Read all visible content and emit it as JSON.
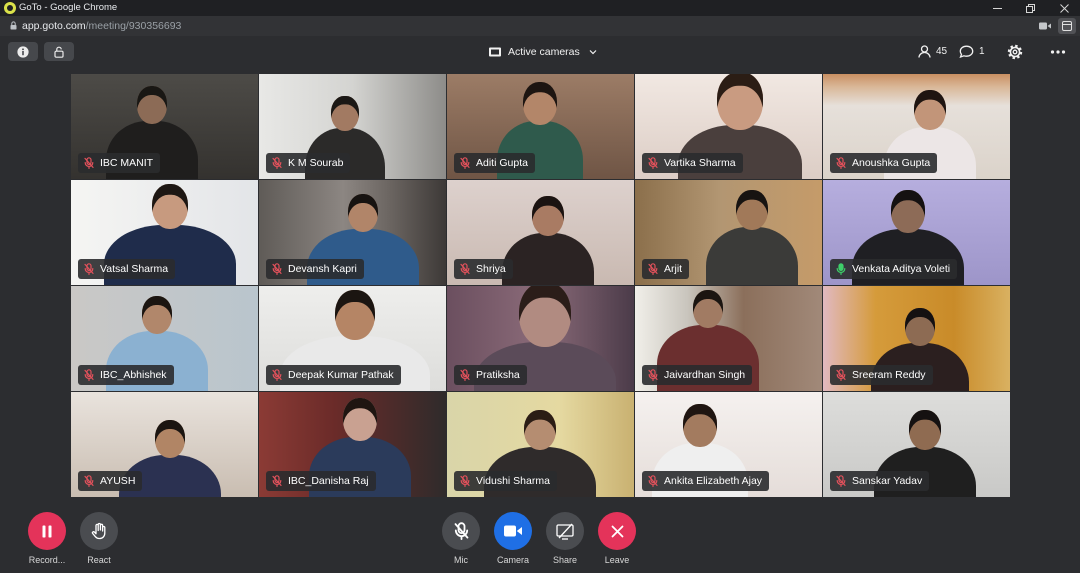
{
  "browser": {
    "window_title": "GoTo - Google Chrome",
    "url_host": "app.goto.com",
    "url_path": "/meeting/930356693"
  },
  "meeting_toolbar": {
    "view_mode": "Active cameras",
    "participant_count": "45",
    "chat_unread_count": "1"
  },
  "participants": [
    {
      "name": "IBC MANIT",
      "muted": true
    },
    {
      "name": "K M Sourab",
      "muted": true
    },
    {
      "name": "Aditi Gupta",
      "muted": true
    },
    {
      "name": "Vartika Sharma",
      "muted": true
    },
    {
      "name": "Anoushka Gupta",
      "muted": true
    },
    {
      "name": "Vatsal Sharma",
      "muted": true
    },
    {
      "name": "Devansh Kapri",
      "muted": true
    },
    {
      "name": "Shriya",
      "muted": true
    },
    {
      "name": "Arjit",
      "muted": true
    },
    {
      "name": "Venkata Aditya Voleti",
      "muted": false
    },
    {
      "name": "IBC_Abhishek",
      "muted": true
    },
    {
      "name": "Deepak Kumar Pathak",
      "muted": true
    },
    {
      "name": "Pratiksha",
      "muted": true
    },
    {
      "name": "Jaivardhan Singh",
      "muted": true
    },
    {
      "name": "Sreeram Reddy",
      "muted": true
    },
    {
      "name": "AYUSH",
      "muted": true
    },
    {
      "name": "IBC_Danisha Raj",
      "muted": true
    },
    {
      "name": "Vidushi Sharma",
      "muted": true
    },
    {
      "name": "Ankita Elizabeth Ajay",
      "muted": true
    },
    {
      "name": "Sanskar Yadav",
      "muted": true
    }
  ],
  "controls": {
    "record": {
      "label": "Record...",
      "icon": "pause-icon"
    },
    "react": {
      "label": "React",
      "icon": "hand-icon"
    },
    "mic": {
      "label": "Mic",
      "icon": "mic-off-icon"
    },
    "camera": {
      "label": "Camera",
      "icon": "video-camera-icon"
    },
    "share": {
      "label": "Share",
      "icon": "screen-share-off-icon"
    },
    "leave": {
      "label": "Leave",
      "icon": "close-icon"
    }
  },
  "colors": {
    "background": "#2c2d30",
    "record_and_leave": "#e4335a",
    "camera_on": "#1f6fe5",
    "mic_muted": "#e5525c",
    "mic_active": "#3ecf6a"
  }
}
